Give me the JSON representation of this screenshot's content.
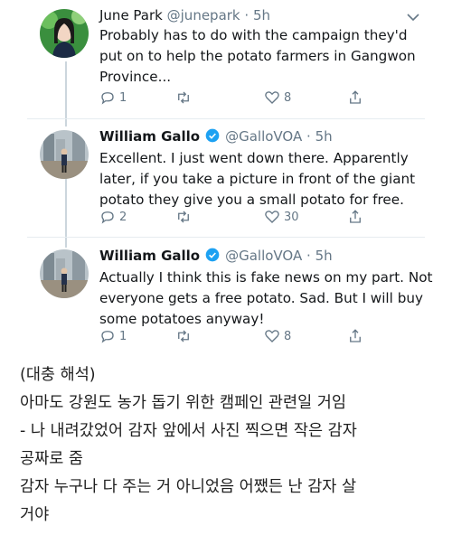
{
  "tweets": [
    {
      "name": "June Park",
      "handle": "@junepark",
      "time": "· 5h",
      "verified": false,
      "text": "Probably has to do with the campaign they'd put on to help the potato farmers in Gangwon Province...",
      "replies": "1",
      "retweets": "",
      "likes": "8"
    },
    {
      "name": "William Gallo",
      "handle": "@GalloVOA",
      "time": "· 5h",
      "verified": true,
      "text": "Excellent. I just went down there. Apparently later, if you take a picture in front of the giant potato they give you a small potato for free.",
      "replies": "2",
      "retweets": "",
      "likes": "30"
    },
    {
      "name": "William Gallo",
      "handle": "@GalloVOA",
      "time": "· 5h",
      "verified": true,
      "text": "Actually I think this is fake news on my part. Not everyone gets a free potato. Sad. But I will buy some potatoes anyway!",
      "replies": "1",
      "retweets": "",
      "likes": "8"
    }
  ],
  "note": {
    "lines": [
      "(대충 해석)",
      "아마도 강원도 농가 돕기 위한 캠페인 관련일 거임",
      "- 나 내려갔었어 감자 앞에서 사진 찍으면 작은 감자",
      "공짜로 줌",
      "감자 누구나 다 주는 거 아니었음 어쨌든 난 감자 살",
      "거야"
    ]
  },
  "colors": {
    "verified": "#1da1f2",
    "muted": "#657786",
    "line": "#ccd6dd"
  },
  "icons": [
    "reply-icon",
    "retweet-icon",
    "like-icon",
    "share-icon",
    "verified-icon",
    "caret-down-icon"
  ]
}
